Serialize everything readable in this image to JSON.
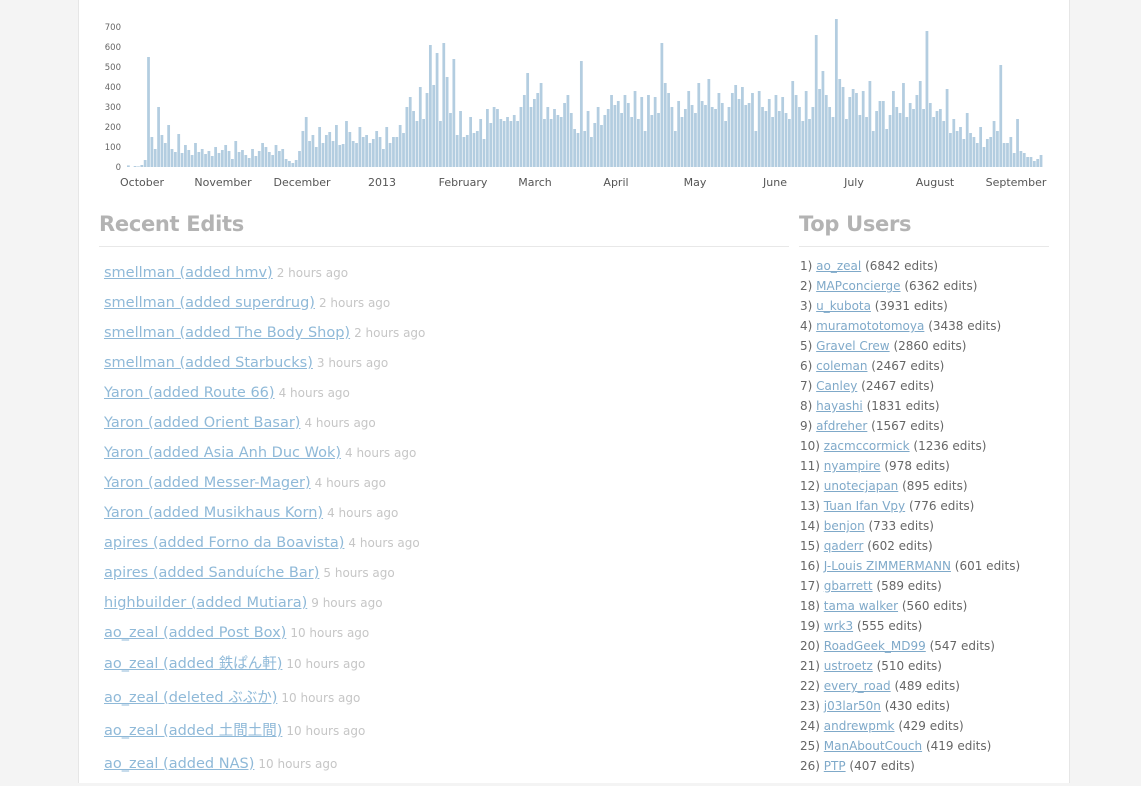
{
  "chart_data": {
    "type": "bar",
    "title": "",
    "xlabel": "",
    "ylabel": "",
    "ylim": [
      0,
      700
    ],
    "yticks": [
      0,
      100,
      200,
      300,
      400,
      500,
      600,
      700
    ],
    "x_tick_labels": [
      "October",
      "November",
      "December",
      "2013",
      "February",
      "March",
      "April",
      "May",
      "June",
      "July",
      "August",
      "September"
    ],
    "color": "#b3cde0",
    "unit": "edits per day",
    "values": [
      8,
      0,
      5,
      3,
      10,
      35,
      550,
      150,
      90,
      300,
      160,
      120,
      210,
      90,
      75,
      165,
      70,
      110,
      85,
      60,
      120,
      75,
      90,
      65,
      80,
      55,
      100,
      70,
      85,
      110,
      80,
      40,
      130,
      75,
      85,
      60,
      45,
      90,
      55,
      80,
      120,
      100,
      75,
      60,
      110,
      80,
      90,
      40,
      30,
      20,
      35,
      80,
      180,
      250,
      130,
      160,
      100,
      200,
      120,
      160,
      175,
      130,
      210,
      110,
      115,
      230,
      175,
      130,
      120,
      200,
      150,
      160,
      120,
      140,
      180,
      150,
      90,
      200,
      120,
      150,
      150,
      210,
      170,
      300,
      350,
      280,
      230,
      400,
      240,
      370,
      610,
      410,
      570,
      230,
      620,
      450,
      270,
      540,
      160,
      280,
      150,
      160,
      250,
      170,
      180,
      240,
      140,
      290,
      220,
      300,
      290,
      240,
      230,
      250,
      230,
      260,
      230,
      300,
      360,
      470,
      300,
      340,
      370,
      420,
      240,
      300,
      240,
      290,
      260,
      250,
      320,
      360,
      270,
      190,
      170,
      530,
      180,
      280,
      150,
      220,
      300,
      210,
      260,
      290,
      360,
      310,
      330,
      270,
      360,
      320,
      250,
      380,
      240,
      350,
      180,
      360,
      260,
      350,
      270,
      620,
      420,
      370,
      300,
      180,
      330,
      250,
      290,
      380,
      310,
      270,
      420,
      330,
      310,
      440,
      300,
      290,
      370,
      320,
      230,
      300,
      370,
      410,
      340,
      400,
      310,
      320,
      370,
      180,
      380,
      300,
      280,
      340,
      250,
      360,
      280,
      350,
      270,
      240,
      430,
      360,
      300,
      230,
      380,
      240,
      300,
      660,
      390,
      480,
      360,
      300,
      250,
      740,
      440,
      400,
      240,
      350,
      390,
      370,
      260,
      380,
      250,
      430,
      180,
      280,
      330,
      330,
      190,
      260,
      380,
      300,
      270,
      420,
      250,
      320,
      290,
      360,
      430,
      290,
      680,
      320,
      250,
      280,
      290,
      230,
      390,
      170,
      240,
      180,
      200,
      140,
      270,
      170,
      150,
      120,
      200,
      100,
      140,
      150,
      230,
      180,
      510,
      120,
      120,
      150,
      70,
      240,
      80,
      70,
      50,
      50,
      30,
      40,
      60
    ],
    "months_covered": "October 2012 – September 2013"
  },
  "recent_edits": {
    "title": "Recent Edits",
    "items": [
      {
        "text": "smellman (added hmv)",
        "ago": "2 hours ago"
      },
      {
        "text": "smellman (added superdrug)",
        "ago": "2 hours ago"
      },
      {
        "text": "smellman (added The Body Shop)",
        "ago": "2 hours ago"
      },
      {
        "text": "smellman (added Starbucks)",
        "ago": "3 hours ago"
      },
      {
        "text": "Yaron (added Route 66)",
        "ago": "4 hours ago"
      },
      {
        "text": "Yaron (added Orient Basar)",
        "ago": "4 hours ago"
      },
      {
        "text": "Yaron (added Asia Anh Duc Wok)",
        "ago": "4 hours ago"
      },
      {
        "text": "Yaron (added Messer-Mager)",
        "ago": "4 hours ago"
      },
      {
        "text": "Yaron (added Musikhaus Korn)",
        "ago": "4 hours ago"
      },
      {
        "text": "apires (added Forno da Boavista)",
        "ago": "4 hours ago"
      },
      {
        "text": "apires (added Sanduíche Bar)",
        "ago": "5 hours ago"
      },
      {
        "text": "highbuilder (added Mutiara)",
        "ago": "9 hours ago"
      },
      {
        "text": "ao_zeal (added Post Box)",
        "ago": "10 hours ago"
      },
      {
        "text": "ao_zeal (added 鉄ぱん軒)",
        "ago": "10 hours ago"
      },
      {
        "text": "ao_zeal (deleted ぶぶか)",
        "ago": "10 hours ago"
      },
      {
        "text": "ao_zeal (added 土間土間)",
        "ago": "10 hours ago"
      },
      {
        "text": "ao_zeal (added NAS)",
        "ago": "10 hours ago"
      }
    ]
  },
  "top_users": {
    "title": "Top Users",
    "items": [
      {
        "rank": "1)",
        "name": "ao_zeal",
        "edits": "(6842 edits)"
      },
      {
        "rank": "2)",
        "name": "MAPconcierge",
        "edits": "(6362 edits)"
      },
      {
        "rank": "3)",
        "name": "u_kubota",
        "edits": "(3931 edits)"
      },
      {
        "rank": "4)",
        "name": "muramototomoya",
        "edits": "(3438 edits)"
      },
      {
        "rank": "5)",
        "name": "Gravel Crew",
        "edits": "(2860 edits)"
      },
      {
        "rank": "6)",
        "name": "coleman",
        "edits": "(2467 edits)"
      },
      {
        "rank": "7)",
        "name": "Canley",
        "edits": "(2467 edits)"
      },
      {
        "rank": "8)",
        "name": "hayashi",
        "edits": "(1831 edits)"
      },
      {
        "rank": "9)",
        "name": "afdreher",
        "edits": "(1567 edits)"
      },
      {
        "rank": "10)",
        "name": "zacmccormick",
        "edits": "(1236 edits)"
      },
      {
        "rank": "11)",
        "name": "nyampire",
        "edits": "(978 edits)"
      },
      {
        "rank": "12)",
        "name": "unotecjapan",
        "edits": "(895 edits)"
      },
      {
        "rank": "13)",
        "name": "Tuan Ifan Vpy",
        "edits": "(776 edits)"
      },
      {
        "rank": "14)",
        "name": "benjon",
        "edits": "(733 edits)"
      },
      {
        "rank": "15)",
        "name": "qaderr",
        "edits": "(602 edits)"
      },
      {
        "rank": "16)",
        "name": "J-Louis ZIMMERMANN",
        "edits": "(601 edits)"
      },
      {
        "rank": "17)",
        "name": "gbarrett",
        "edits": "(589 edits)"
      },
      {
        "rank": "18)",
        "name": "tama walker",
        "edits": "(560 edits)"
      },
      {
        "rank": "19)",
        "name": "wrk3",
        "edits": "(555 edits)"
      },
      {
        "rank": "20)",
        "name": "RoadGeek_MD99",
        "edits": "(547 edits)"
      },
      {
        "rank": "21)",
        "name": "ustroetz",
        "edits": "(510 edits)"
      },
      {
        "rank": "22)",
        "name": "every_road",
        "edits": "(489 edits)"
      },
      {
        "rank": "23)",
        "name": "j03lar50n",
        "edits": "(430 edits)"
      },
      {
        "rank": "24)",
        "name": "andrewpmk",
        "edits": "(429 edits)"
      },
      {
        "rank": "25)",
        "name": "ManAboutCouch",
        "edits": "(419 edits)"
      },
      {
        "rank": "26)",
        "name": "PTP",
        "edits": "(407 edits)"
      }
    ]
  }
}
